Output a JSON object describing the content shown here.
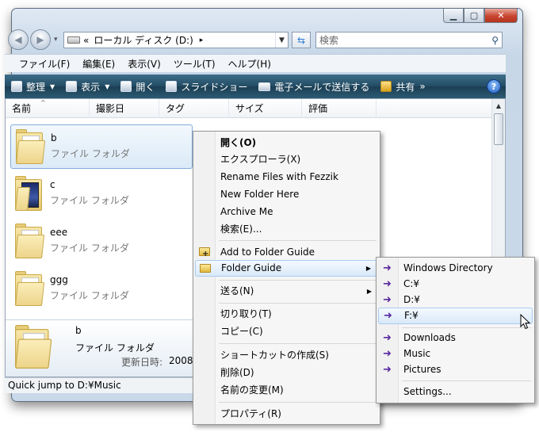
{
  "address": {
    "prefix": "«",
    "path": "ローカル ディスク (D:)",
    "next": "▸"
  },
  "search": {
    "placeholder": "検索"
  },
  "menubar": [
    "ファイル(F)",
    "編集(E)",
    "表示(V)",
    "ツール(T)",
    "ヘルプ(H)"
  ],
  "commandbar": {
    "organize": "整理",
    "view": "表示",
    "open": "開く",
    "slideshow": "スライドショー",
    "email": "電子メールで送信する",
    "share": "共有",
    "more": "»",
    "help": "?"
  },
  "columns": [
    "名前",
    "撮影日",
    "タグ",
    "サイズ",
    "評価"
  ],
  "items": [
    {
      "name": "b",
      "type": "ファイル フォルダ"
    },
    {
      "name": "c",
      "type": "ファイル フォルダ"
    },
    {
      "name": "eee",
      "type": "ファイル フォルダ"
    },
    {
      "name": "ggg",
      "type": "ファイル フォルダ"
    }
  ],
  "details": {
    "name": "b",
    "type": "ファイル フォルダ",
    "modified_label": "更新日時:",
    "modified_value": "2008"
  },
  "status": "Quick jump to D:¥Music",
  "context_menu": {
    "open": "開く(O)",
    "explorer": "エクスプローラ(X)",
    "rename_fezzik": "Rename Files with Fezzik",
    "new_folder_here": "New Folder Here",
    "archive_me": "Archive Me",
    "search": "検索(E)...",
    "add_folder_guide": "Add to Folder Guide",
    "folder_guide": "Folder Guide",
    "send_to": "送る(N)",
    "cut": "切り取り(T)",
    "copy": "コピー(C)",
    "create_shortcut": "ショートカットの作成(S)",
    "delete": "削除(D)",
    "rename": "名前の変更(M)",
    "properties": "プロパティ(R)"
  },
  "submenu": {
    "windows_dir": "Windows Directory",
    "c": "C:¥",
    "d": "D:¥",
    "f": "F:¥",
    "downloads": "Downloads",
    "music": "Music",
    "pictures": "Pictures",
    "settings": "Settings..."
  }
}
